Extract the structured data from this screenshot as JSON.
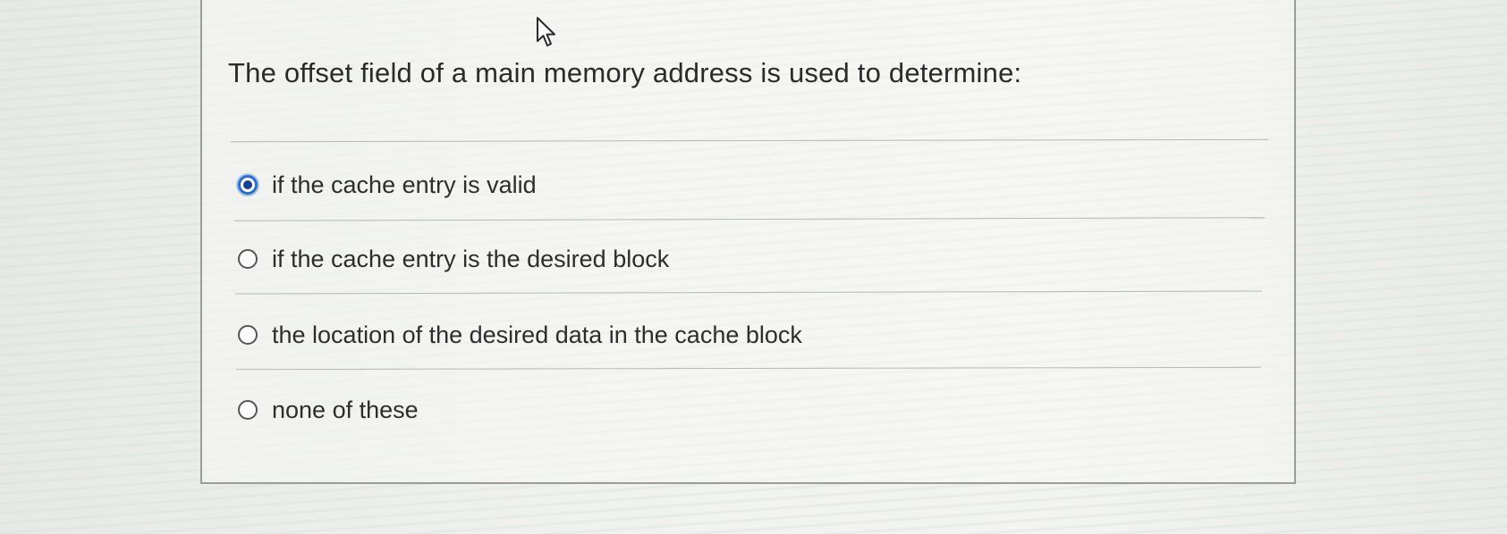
{
  "question": {
    "text": "The offset field of a main memory address is used to determine:"
  },
  "options": [
    {
      "label": "if the cache entry is valid",
      "selected": true
    },
    {
      "label": "if the cache entry is the desired block",
      "selected": false
    },
    {
      "label": "the location of the desired data in the cache block",
      "selected": false
    },
    {
      "label": "none of these",
      "selected": false
    }
  ],
  "colors": {
    "selected_radio": "#2a6fc9",
    "panel_border": "#9a9c9c",
    "text": "#2b2b2b"
  },
  "icons": {
    "cursor": "mouse-pointer-arrow-icon"
  }
}
